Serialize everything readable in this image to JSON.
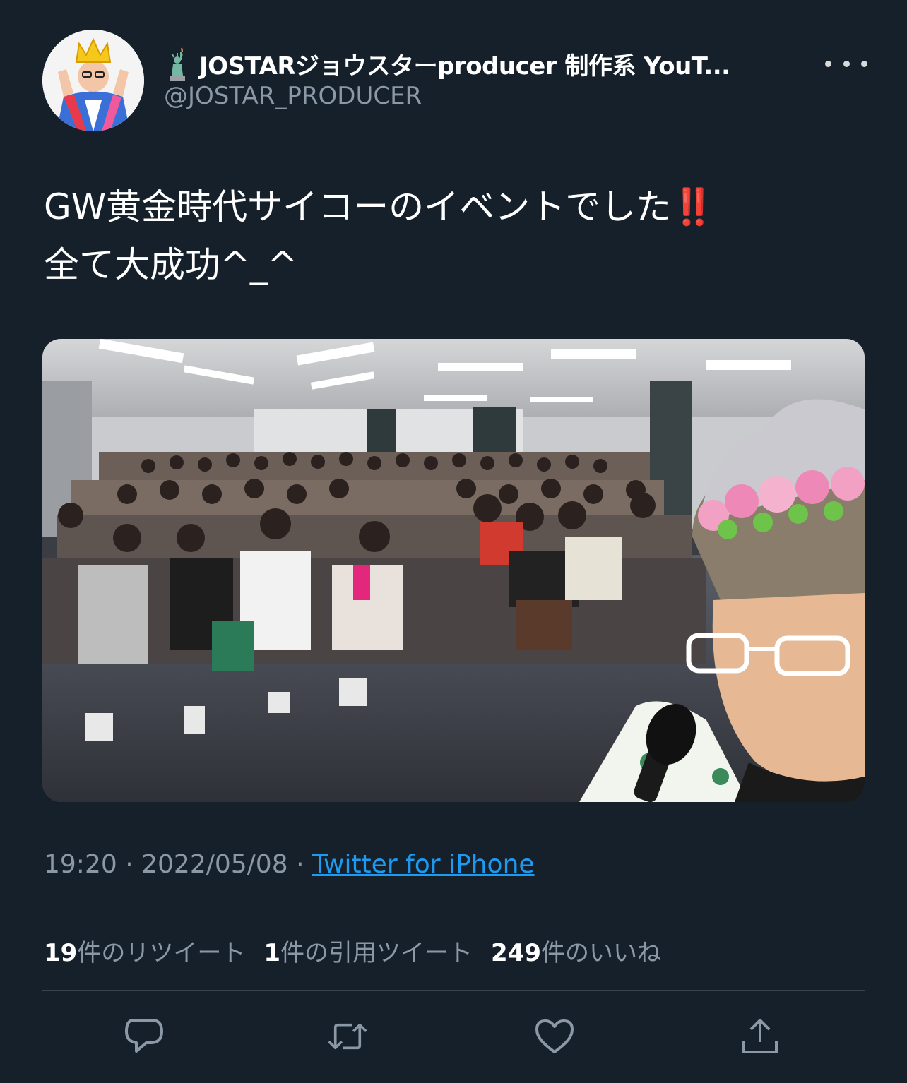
{
  "header": {
    "display_name": "JOSTARジョウスターproducer 制作系 YouT...",
    "handle": "@JOSTAR_PRODUCER"
  },
  "tweet": {
    "text_lines": [
      "GW黄金時代サイコーのイベントでした‼️",
      "全て大成功^_^"
    ],
    "time": "19:20",
    "separator": "·",
    "date": "2022/05/08",
    "source": "Twitter for iPhone"
  },
  "stats": {
    "retweets_count": "19",
    "retweets_label": "件のリツイート",
    "quotes_count": "1",
    "quotes_label": "件の引用ツイート",
    "likes_count": "249",
    "likes_label": "件のいいね"
  },
  "icons": [
    "statue-of-liberty-icon",
    "more-icon",
    "reply-icon",
    "retweet-icon",
    "like-icon",
    "share-icon"
  ],
  "colors": {
    "background": "#15202b",
    "text": "#ffffff",
    "secondary_text": "#8b98a5",
    "link": "#1d9bf0",
    "divider": "#38444d"
  }
}
